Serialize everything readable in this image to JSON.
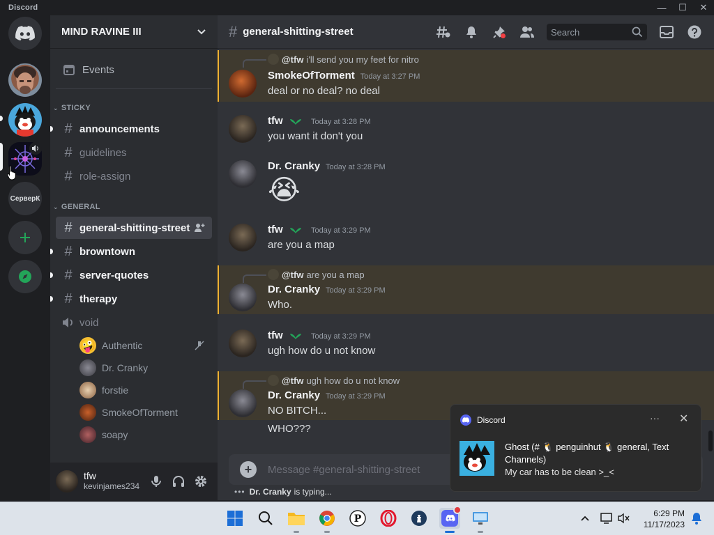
{
  "window": {
    "title": "Discord",
    "controls": [
      "—",
      "☐",
      "✕"
    ]
  },
  "servers": [
    {
      "name": "home",
      "icon": "discord-logo-icon"
    },
    {
      "name": "server-avatar-1"
    },
    {
      "name": "server-avatar-2"
    },
    {
      "name": "mind-ravine-iii",
      "selected": true
    },
    {
      "name": "text-server",
      "label": "СерверК"
    },
    {
      "name": "add-server",
      "icon": "plus-icon"
    },
    {
      "name": "explore",
      "icon": "compass-icon"
    }
  ],
  "guild": {
    "name": "MIND RAVINE III"
  },
  "events_label": "Events",
  "categories": {
    "sticky": "STICKY",
    "general": "GENERAL"
  },
  "channels": [
    {
      "name": "announcements",
      "state": "unread"
    },
    {
      "name": "guidelines",
      "state": "read"
    },
    {
      "name": "role-assign",
      "state": "read"
    },
    {
      "name": "general-shitting-street",
      "state": "selected"
    },
    {
      "name": "browntown",
      "state": "unread"
    },
    {
      "name": "server-quotes",
      "state": "unread"
    },
    {
      "name": "therapy",
      "state": "unread"
    }
  ],
  "voice_channel": {
    "name": "void"
  },
  "voice_users": [
    "Authentic",
    "Dr. Cranky",
    "forstie",
    "SmokeOfTorment",
    "soapy"
  ],
  "user": {
    "name": "tfw",
    "tag": "kevinjames234"
  },
  "chat": {
    "channel": "general-shitting-street",
    "search_placeholder": "Search",
    "composer_placeholder": "Message #general-shitting-street",
    "typing_user": "Dr. Cranky",
    "typing_text": "is typing..."
  },
  "messages": [
    {
      "reply_to": "@tfw",
      "reply_text": "i'll send you my feet for nitro",
      "author": "SmokeOfTorment",
      "time": "Today at 3:27 PM",
      "text": "deal or no deal? no deal",
      "mention": true
    },
    {
      "author": "tfw",
      "time": "Today at 3:28 PM",
      "text": "you want it don't you"
    },
    {
      "author": "Dr. Cranky",
      "time": "Today at 3:28 PM",
      "text": "😭"
    },
    {
      "author": "tfw",
      "time": "Today at 3:29 PM",
      "text": "are you a map"
    },
    {
      "reply_to": "@tfw",
      "reply_text": "are you a map",
      "author": "Dr. Cranky",
      "time": "Today at 3:29 PM",
      "text": "Who.",
      "mention": true
    },
    {
      "author": "tfw",
      "time": "Today at 3:29 PM",
      "text": "ugh how do u not know"
    },
    {
      "reply_to": "@tfw",
      "reply_text": "ugh how do u not know",
      "author": "Dr. Cranky",
      "time": "Today at 3:29 PM",
      "text": "NO BITCH...",
      "mention": true
    },
    {
      "text": "WHO???"
    }
  ],
  "toast": {
    "app": "Discord",
    "more": "···",
    "close": "✕",
    "title": "Ghost (# 🐧 penguinhut 🐧 general, Text Channels)",
    "body": "My car has to be clean >_<"
  },
  "taskbar": {
    "apps": [
      "start",
      "search",
      "file-explorer",
      "chrome",
      "p-app",
      "opera",
      "app-6",
      "discord",
      "app-8"
    ],
    "time": "6:29 PM",
    "date": "11/17/2023"
  },
  "colors": {
    "accent": "#5865f2",
    "mention_bg": "#3f3a2f",
    "mention_bar": "#f0b232",
    "nitro_badge": "#23a559"
  }
}
